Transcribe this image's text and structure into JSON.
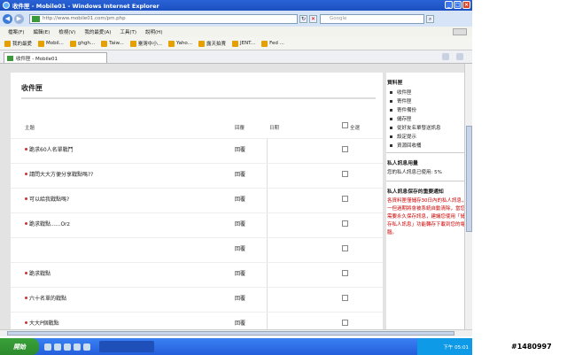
{
  "window": {
    "title": "收件匣 - Mobile01 - Windows Internet Explorer"
  },
  "address": {
    "url": "http://www.mobile01.com/pm.php",
    "search_placeholder": "Google"
  },
  "menu": [
    "檔案(F)",
    "編輯(E)",
    "檢視(V)",
    "我的最愛(A)",
    "工具(T)",
    "說明(H)"
  ],
  "favorites": {
    "label": "我的最愛",
    "items": [
      "Mobil...",
      "ghgh...",
      "Taiw...",
      "臺灣中小...",
      "Yaho...",
      "露天拍賣",
      "JENT...",
      "Fed ..."
    ]
  },
  "tab": {
    "label": "收件匣 - Mobile01"
  },
  "inbox": {
    "heading": "收件匣",
    "columns": {
      "subject": "主題",
      "status": "回覆",
      "date": "日期",
      "select_all": "全選"
    },
    "rows": [
      {
        "subject": "跪求60人名單戰鬥",
        "status": "回覆"
      },
      {
        "subject": "請問大大方便分享戰點嗎??",
        "status": "回覆"
      },
      {
        "subject": "可以給我戰點嗎?",
        "status": "回覆"
      },
      {
        "subject": "跪求戰點......Orz",
        "status": "回覆"
      },
      {
        "subject": "",
        "status": "回覆"
      },
      {
        "subject": "跪求戰點",
        "status": "回覆"
      },
      {
        "subject": "六十名單的戰點",
        "status": "回覆"
      },
      {
        "subject": "大大P個戰點",
        "status": "回覆"
      }
    ]
  },
  "sidebar": {
    "folders_title": "資料匣",
    "folders": [
      "收件匣",
      "寄件匣",
      "寄件備份",
      "儲存匣",
      "從好友名單發送訊息",
      "設定提示",
      "資源回收桶"
    ],
    "usage_title": "私人訊息用量",
    "usage_text": "您的私人訊息已使用: 5%",
    "notice_title": "私人訊息保存的重要通知",
    "notice_text": "各資料匣僅儲存30日內的私人訊息，一但過期將會被系統自動清除，當您需要永久保存訊息，建議您使用「儲存私人訊息」功能轉存下載到您的電腦。"
  },
  "taskbar": {
    "start_label": "開始",
    "time": "下午 05:01"
  },
  "watermark": "#1480997"
}
